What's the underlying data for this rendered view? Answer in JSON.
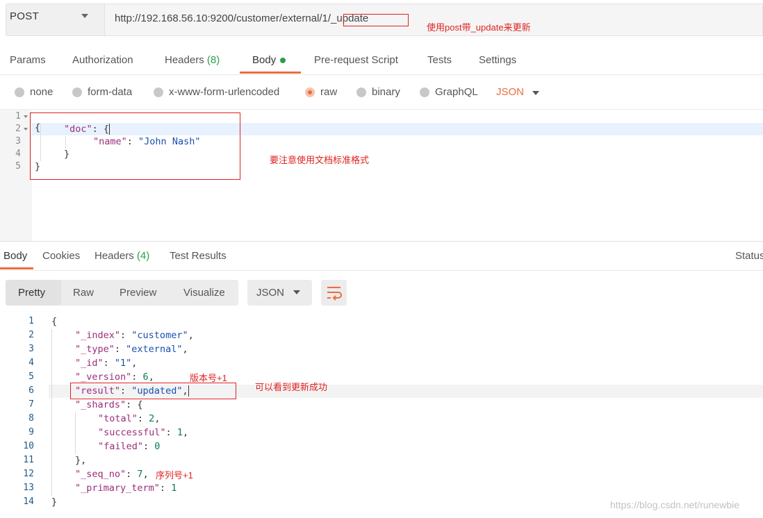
{
  "request": {
    "method": "POST",
    "url": "http://192.168.56.10:9200/customer/external/1/_update"
  },
  "annotations": {
    "url_note": "使用post带_update来更新",
    "doc_note": "要注意使用文档标准格式",
    "version_note": "版本号+1",
    "result_note": "可以看到更新成功",
    "seq_note": "序列号+1"
  },
  "request_tabs": {
    "params": "Params",
    "authorization": "Authorization",
    "headers": "Headers",
    "headers_count": "(8)",
    "body": "Body",
    "prerequest": "Pre-request Script",
    "tests": "Tests",
    "settings": "Settings"
  },
  "body_types": {
    "none": "none",
    "form_data": "form-data",
    "urlencoded": "x-www-form-urlencoded",
    "raw": "raw",
    "binary": "binary",
    "graphql": "GraphQL",
    "language": "JSON"
  },
  "request_body": {
    "line_numbers": [
      "1",
      "2",
      "3",
      "4",
      "5"
    ],
    "open": "{",
    "doc_key": "\"doc\"",
    "doc_open": ": {",
    "name_key": "\"name\"",
    "colon": ": ",
    "name_value": "\"John Nash\"",
    "inner_close": "}",
    "close": "}"
  },
  "response_tabs": {
    "body": "Body",
    "cookies": "Cookies",
    "headers": "Headers",
    "headers_count": "(4)",
    "test_results": "Test Results",
    "status": "Status"
  },
  "response_toolbar": {
    "pretty": "Pretty",
    "raw": "Raw",
    "preview": "Preview",
    "visualize": "Visualize",
    "format": "JSON",
    "wrap_icon": "wrap-lines-icon"
  },
  "response_body": {
    "line_numbers": [
      "1",
      "2",
      "3",
      "4",
      "5",
      "6",
      "7",
      "8",
      "9",
      "10",
      "11",
      "12",
      "13",
      "14"
    ],
    "open": "{",
    "index_key": "\"_index\"",
    "index_val": "\"customer\"",
    "type_key": "\"_type\"",
    "type_val": "\"external\"",
    "id_key": "\"_id\"",
    "id_val": "\"1\"",
    "version_key": "\"_version\"",
    "version_val": "6",
    "result_key": "\"result\"",
    "result_val": "\"updated\"",
    "shards_key": "\"_shards\"",
    "shards_open": ": {",
    "total_key": "\"total\"",
    "total_val": "2",
    "successful_key": "\"successful\"",
    "successful_val": "1",
    "failed_key": "\"failed\"",
    "failed_val": "0",
    "shards_close": "},",
    "seq_key": "\"_seq_no\"",
    "seq_val": "7",
    "primary_key": "\"_primary_term\"",
    "primary_val": "1",
    "close": "}",
    "colon": ": ",
    "comma": ","
  },
  "watermark": "https://blog.csdn.net/runewbie",
  "colors": {
    "accent": "#ed6c3a",
    "annotation": "#e02020",
    "count": "#2a9d4a"
  }
}
